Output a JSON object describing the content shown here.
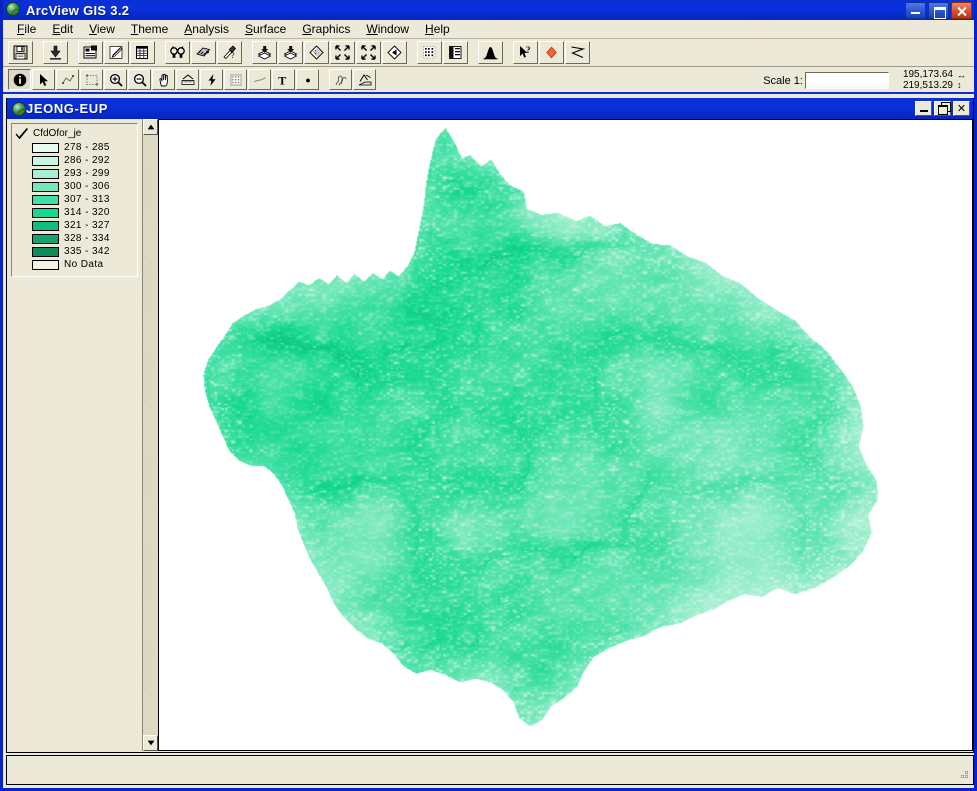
{
  "app": {
    "title": "ArcView GIS 3.2",
    "icon": "globe-magnifier-icon",
    "caption_buttons": [
      {
        "name": "minimize",
        "label": ""
      },
      {
        "name": "maximize",
        "label": ""
      },
      {
        "name": "close",
        "label": ""
      }
    ]
  },
  "menu": {
    "items": [
      {
        "label": "File",
        "mnemonic": "F"
      },
      {
        "label": "Edit",
        "mnemonic": "E"
      },
      {
        "label": "View",
        "mnemonic": "V"
      },
      {
        "label": "Theme",
        "mnemonic": "T"
      },
      {
        "label": "Analysis",
        "mnemonic": "A"
      },
      {
        "label": "Surface",
        "mnemonic": "S"
      },
      {
        "label": "Graphics",
        "mnemonic": "G"
      },
      {
        "label": "Window",
        "mnemonic": "W"
      },
      {
        "label": "Help",
        "mnemonic": "H"
      }
    ]
  },
  "toolbar_main": {
    "buttons": [
      {
        "name": "save-project-icon",
        "tip": "Save Project"
      },
      {
        "name": "add-theme-icon",
        "tip": "Add Theme"
      },
      {
        "name": "theme-properties-icon",
        "tip": "Theme Properties"
      },
      {
        "name": "edit-legend-icon",
        "tip": "Edit Legend"
      },
      {
        "name": "open-theme-table-icon",
        "tip": "Open Theme Table"
      },
      {
        "name": "find-icon",
        "tip": "Find"
      },
      {
        "name": "locate-address-icon",
        "tip": "Locate Address"
      },
      {
        "name": "query-builder-icon",
        "tip": "Query Builder"
      },
      {
        "name": "zoom-to-selected-icon",
        "tip": "Zoom to Selected"
      },
      {
        "name": "zoom-to-themes-icon",
        "tip": "Zoom to Themes"
      },
      {
        "name": "zoom-to-active-themes-icon",
        "tip": "Zoom to Active Themes"
      },
      {
        "name": "zoom-in-icon",
        "tip": "Zoom In"
      },
      {
        "name": "zoom-out-icon",
        "tip": "Zoom Out"
      },
      {
        "name": "zoom-previous-icon",
        "tip": "Zoom to Previous Extent"
      },
      {
        "name": "select-feature-icon",
        "tip": "Select Feature"
      },
      {
        "name": "clear-selected-icon",
        "tip": "Clear Selected Features"
      },
      {
        "name": "histogram-icon",
        "tip": "Histogram"
      },
      {
        "name": "help-pointer-icon",
        "tip": "Help"
      },
      {
        "name": "hot-link-icon",
        "tip": "Hot Link"
      },
      {
        "name": "profile-icon",
        "tip": "Profile"
      }
    ]
  },
  "toolbar_tools": {
    "buttons": [
      {
        "name": "identify-tool-icon",
        "tip": "Identify",
        "active": true
      },
      {
        "name": "pointer-tool-icon",
        "tip": "Pointer"
      },
      {
        "name": "vertex-edit-tool-icon",
        "tip": "Vertex Edit"
      },
      {
        "name": "select-box-tool-icon",
        "tip": "Select Features"
      },
      {
        "name": "zoom-in-tool-icon",
        "tip": "Zoom In"
      },
      {
        "name": "zoom-out-tool-icon",
        "tip": "Zoom Out"
      },
      {
        "name": "pan-tool-icon",
        "tip": "Pan"
      },
      {
        "name": "measure-tool-icon",
        "tip": "Measure"
      },
      {
        "name": "hot-link-tool-icon",
        "tip": "Hot Link"
      },
      {
        "name": "label-tool-icon",
        "tip": "Label"
      },
      {
        "name": "draw-tool-icon",
        "tip": "Draw"
      },
      {
        "name": "text-tool-icon",
        "tip": "Text"
      },
      {
        "name": "draw-point-tool-icon",
        "tip": "Draw Point"
      },
      {
        "name": "contour-tool-icon",
        "tip": "Contour"
      },
      {
        "name": "line-of-sight-tool-icon",
        "tip": "Line of Sight"
      }
    ]
  },
  "scale": {
    "label": "Scale 1:",
    "value": "",
    "placeholder": ""
  },
  "coordinates": {
    "x": "195,173.64",
    "y": "219,513.29",
    "x_icon": "horizontal-arrows-icon",
    "y_icon": "vertical-arrows-icon"
  },
  "view_window": {
    "title": "JEONG-EUP",
    "icon": "globe-magnifier-icon",
    "buttons": [
      {
        "name": "minimize",
        "label": ""
      },
      {
        "name": "restore",
        "label": ""
      },
      {
        "name": "close",
        "label": "✕"
      }
    ]
  },
  "legend": {
    "theme_name": "CfdOfor_je",
    "checked": true,
    "classes": [
      {
        "label": "278 - 285",
        "color": "#e9fbf3"
      },
      {
        "label": "286 - 292",
        "color": "#c9f6e2"
      },
      {
        "label": "293 - 299",
        "color": "#a5f0d0"
      },
      {
        "label": "300 - 306",
        "color": "#72e8ba"
      },
      {
        "label": "307 - 313",
        "color": "#3fe0a3"
      },
      {
        "label": "314 - 320",
        "color": "#14d98e"
      },
      {
        "label": "321 - 327",
        "color": "#12bd7d"
      },
      {
        "label": "328 - 334",
        "color": "#17a36d"
      },
      {
        "label": "335 - 342",
        "color": "#0f8a59"
      },
      {
        "label": "No Data",
        "color": "#f4f1e2"
      }
    ],
    "scrollbar": {
      "up_icon": "scroll-up-arrow-icon",
      "down_icon": "scroll-down-arrow-icon"
    }
  },
  "map": {
    "name": "jeong-eup-elevation-raster",
    "background": "#ffffff",
    "description": "Shaded elevation / DEM raster of Jeong-eup administrative area rendered in a green colour ramp with pale drainage lines"
  },
  "status_bar": {
    "message": "",
    "grip_icon": "resize-grip-icon"
  }
}
